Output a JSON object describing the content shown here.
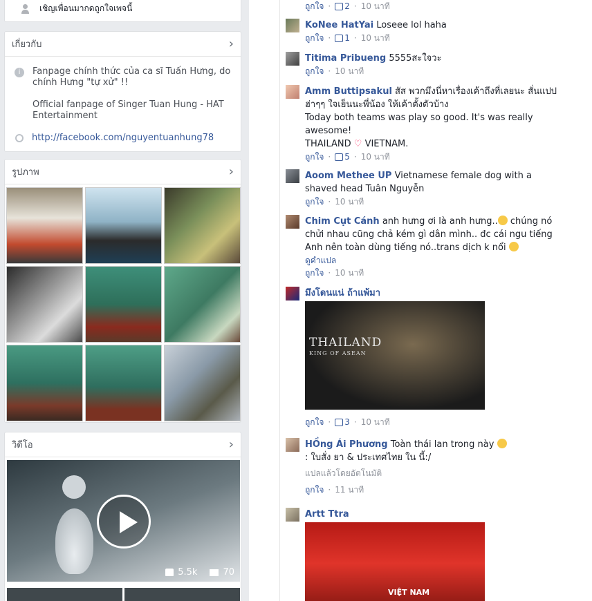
{
  "left": {
    "invite": {
      "text": "เชิญเพื่อนมากดถูกใจเพจนี้"
    },
    "about": {
      "title": "เกี่ยวกับ",
      "desc1": "Fanpage chính thức của ca sĩ Tuấn Hưng, do chính Hưng \"tự xử\" !!",
      "desc2": "Official fanpage of Singer Tuan Hung - HAT Entertainment",
      "link": "http://facebook.com/nguyentuanhung78"
    },
    "photos": {
      "title": "รูปภาพ"
    },
    "videos": {
      "title": "วิดีโอ",
      "likes": "5.5k",
      "comments": "70"
    }
  },
  "comments": [
    {
      "actions": {
        "like": "ถูกใจ",
        "count": "2",
        "time": "10 นาที"
      }
    },
    {
      "name": "KoNee HatYai",
      "text": "Loseee lol haha",
      "actions": {
        "like": "ถูกใจ",
        "count": "1",
        "time": "10 นาที"
      }
    },
    {
      "name": "Titima Pribueng",
      "text": "5555สะใจวะ",
      "actions": {
        "like": "ถูกใจ",
        "time": "10 นาที"
      }
    },
    {
      "name": "Amm Buttipsakul",
      "text": "สัส พวกมึงนี่หาเรื่องเค้าถึงที่เลยนะ สั่นแปป ฮ่าๆๆ ใจเย็นนะพี่น้อง ให้เค้าตั้งตัวบ้าง",
      "text2": "Today both teams was play so good. It's was really awesome!",
      "text3a": "THAILAND",
      "text3b": "VIETNAM.",
      "actions": {
        "like": "ถูกใจ",
        "count": "5",
        "time": "10 นาที"
      }
    },
    {
      "name": "Aoom Methee UP",
      "text": "Vietnamese female dog with a shaved head Tuân Nguyễn",
      "actions": {
        "like": "ถูกใจ",
        "time": "10 นาที"
      }
    },
    {
      "name": "Chim Cụt Cánh",
      "text": "anh hưng ơi là anh hưng..",
      "text2": "chúng nó chửi nhau cũng chả kém gì dân mình.. đc cái ngu tiếng Anh nên toàn dùng tiếng nó..trans dịch k nổi",
      "see_translation": "ดูคำแปล",
      "actions": {
        "like": "ถูกใจ",
        "time": "10 นาที"
      }
    },
    {
      "name": "มึงโดนแน่ ถ้าแพ้มา",
      "image_title": "THAILAND",
      "image_sub": "KING OF ASEAN",
      "actions": {
        "like": "ถูกใจ",
        "count": "3",
        "time": "10 นาที"
      }
    },
    {
      "name": "HỒng Ái Phương",
      "text": "Toàn thái lan trong này",
      "translated": ": ใบสั่ง ยา & ประเทศไทย ใน นี้:/",
      "auto_translated": "แปลแล้วโดยอัตโนมัติ",
      "actions": {
        "like": "ถูกใจ",
        "time": "11 นาที"
      }
    },
    {
      "name": "Artt Ttra",
      "image_text": "VIỆT NAM"
    }
  ]
}
